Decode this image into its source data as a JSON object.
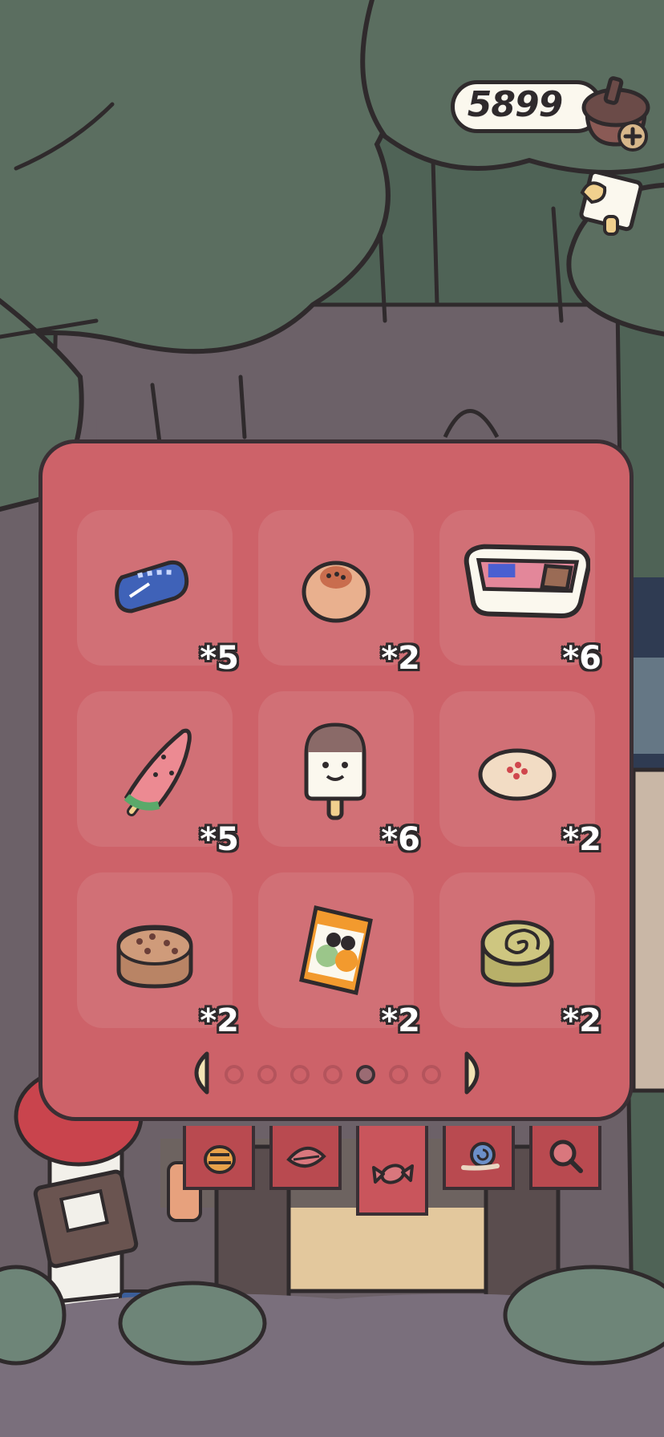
{
  "currency": {
    "amount": "5899",
    "icon": "acorn-icon",
    "add_icon": "plus-icon"
  },
  "journal_button": {
    "icon": "note-icon"
  },
  "inventory": {
    "items": [
      {
        "name": "blue-candy",
        "qty": "*5"
      },
      {
        "name": "bun",
        "qty": "*2"
      },
      {
        "name": "ice-cream-box",
        "qty": "*6"
      },
      {
        "name": "watermelon-popsicle",
        "qty": "*5"
      },
      {
        "name": "smiley-popsicle",
        "qty": "*6"
      },
      {
        "name": "jam-biscuit",
        "qty": "*2"
      },
      {
        "name": "chocolate-chip-cookie",
        "qty": "*2"
      },
      {
        "name": "snack-bag",
        "qty": "*2"
      },
      {
        "name": "swiss-roll-cake",
        "qty": "*2"
      }
    ],
    "pager": {
      "pages": 7,
      "current": 5
    }
  },
  "tabs": [
    {
      "name": "bee-tab",
      "icon": "bee-icon",
      "active": false
    },
    {
      "name": "leaf-tab",
      "icon": "leaf-icon",
      "active": false
    },
    {
      "name": "candy-tab",
      "icon": "candy-icon",
      "active": true
    },
    {
      "name": "snail-tab",
      "icon": "snail-icon",
      "active": false
    },
    {
      "name": "magnifier-tab",
      "icon": "magnifier-icon",
      "active": false
    }
  ],
  "colors": {
    "panel": "#cd6269",
    "outline": "#3a2f34",
    "tree": "#5b6e60"
  }
}
